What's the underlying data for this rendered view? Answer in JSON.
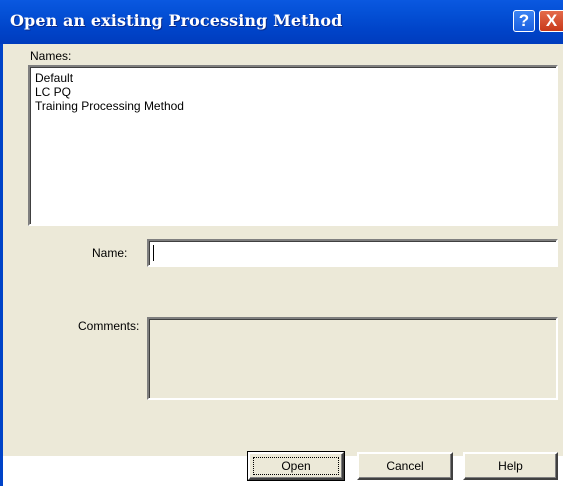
{
  "window": {
    "title": "Open an existing Processing Method",
    "help_glyph": "?",
    "close_glyph": "X"
  },
  "names_section": {
    "label": "Names:",
    "items": [
      "Default",
      "LC PQ",
      "Training Processing Method"
    ]
  },
  "name_field": {
    "label": "Name:",
    "value": ""
  },
  "comments_field": {
    "label": "Comments:",
    "value": ""
  },
  "buttons": {
    "open": "Open",
    "cancel": "Cancel",
    "help": "Help"
  },
  "colors": {
    "titlebar": "#0043c8",
    "dialog_face": "#ece9d8",
    "close_button": "#c8391a"
  },
  "icons": {
    "help": "help-icon",
    "close": "close-icon"
  }
}
